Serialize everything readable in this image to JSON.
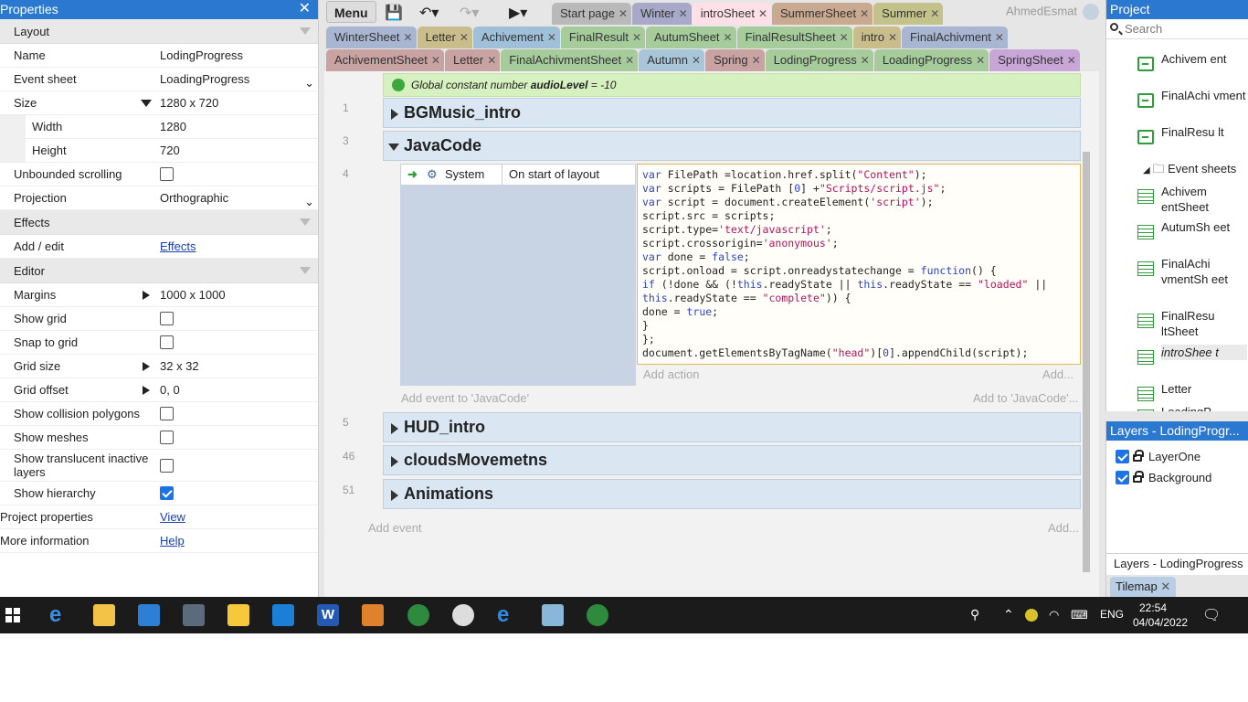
{
  "props": {
    "title": "Properties",
    "sections": {
      "layout": "Layout",
      "effects": "Effects",
      "editor": "Editor"
    },
    "rows": {
      "name": {
        "k": "Name",
        "v": "LodingProgress"
      },
      "event_sheet": {
        "k": "Event sheet",
        "v": "LoadingProgress"
      },
      "size": {
        "k": "Size",
        "v": "1280 x 720"
      },
      "width": {
        "k": "Width",
        "v": "1280"
      },
      "height": {
        "k": "Height",
        "v": "720"
      },
      "unbounded": {
        "k": "Unbounded scrolling"
      },
      "projection": {
        "k": "Projection",
        "v": "Orthographic"
      },
      "add_edit": {
        "k": "Add / edit",
        "v": "Effects"
      },
      "margins": {
        "k": "Margins",
        "v": "1000 x 1000"
      },
      "show_grid": {
        "k": "Show grid"
      },
      "snap": {
        "k": "Snap to grid"
      },
      "grid_size": {
        "k": "Grid size",
        "v": "32 x 32"
      },
      "grid_offset": {
        "k": "Grid offset",
        "v": "0, 0"
      },
      "collision": {
        "k": "Show collision polygons"
      },
      "meshes": {
        "k": "Show meshes"
      },
      "translucent": {
        "k": "Show translucent inactive layers"
      },
      "hierarchy": {
        "k": "Show hierarchy"
      },
      "project_props": {
        "k": "Project properties",
        "v": "View"
      },
      "more_info": {
        "k": "More information",
        "v": "Help"
      }
    }
  },
  "toolbar": {
    "menu": "Menu"
  },
  "user": {
    "name": "AhmedEsmat"
  },
  "tabs_row1": [
    {
      "label": "Start page",
      "color": "#b9b9b9"
    },
    {
      "label": "Winter",
      "color": "#a8a8c8"
    },
    {
      "label": "introSheet",
      "color": "#ffe0e8"
    },
    {
      "label": "SummerSheet",
      "color": "#c9a98f"
    },
    {
      "label": "Summer",
      "color": "#c2c28a"
    }
  ],
  "tabs_row2": [
    {
      "label": "WinterSheet",
      "color": "#a9b6d1"
    },
    {
      "label": "Letter",
      "color": "#c9bd8c"
    },
    {
      "label": "Achivement",
      "color": "#9fc0d8"
    },
    {
      "label": "FinalResult",
      "color": "#a6cc9c"
    },
    {
      "label": "AutumSheet",
      "color": "#a6cc9c"
    },
    {
      "label": "FinalResultSheet",
      "color": "#a6cc9c"
    },
    {
      "label": "intro",
      "color": "#c9bd8c"
    },
    {
      "label": "FinalAchivment",
      "color": "#a9b6d1"
    }
  ],
  "tabs_row3": [
    {
      "label": "AchivementSheet",
      "color": "#c9a2a2"
    },
    {
      "label": "Letter",
      "color": "#c9a2a2"
    },
    {
      "label": "FinalAchivmentSheet",
      "color": "#a6cc9c"
    },
    {
      "label": "Autumn",
      "color": "#a9c6d8"
    },
    {
      "label": "Spring",
      "color": "#c9a2a2"
    },
    {
      "label": "LodingProgress",
      "color": "#a6cc9c"
    },
    {
      "label": "LoadingProgress",
      "color": "#a6cc9c"
    },
    {
      "label": "SpringSheet",
      "color": "#c8a6d8"
    }
  ],
  "events": {
    "global": {
      "prefix": "Global constant number",
      "name": "audioLevel",
      "suffix": "= -10"
    },
    "groups": [
      {
        "line": "1",
        "label": "BGMusic_intro"
      },
      {
        "line": "3",
        "label": "JavaCode"
      },
      {
        "line": "5",
        "label": "HUD_intro"
      },
      {
        "line": "46",
        "label": "cloudsMovemetns"
      },
      {
        "line": "51",
        "label": "Animations"
      }
    ],
    "event_line": "4",
    "condition": {
      "object": "System",
      "text": "On start of layout"
    },
    "add_action": "Add action",
    "add_more": "Add...",
    "add_event_to": "Add event to 'JavaCode'",
    "add_to": "Add to 'JavaCode'...",
    "add_event": "Add event",
    "add_event_more": "Add..."
  },
  "project": {
    "title": "Project",
    "search_placeholder": "Search",
    "items": [
      {
        "label": "Achivem ent",
        "kind": "layout"
      },
      {
        "label": "FinalAchi vment",
        "kind": "layout"
      },
      {
        "label": "FinalResu lt",
        "kind": "layout"
      },
      {
        "label": "Event sheets",
        "kind": "folder"
      },
      {
        "label": "Achivem entSheet",
        "kind": "sheet"
      },
      {
        "label": "AutumSh eet",
        "kind": "sheet"
      },
      {
        "label": "FinalAchi vmentSh eet",
        "kind": "sheet"
      },
      {
        "label": "FinalResu ltSheet",
        "kind": "sheet"
      },
      {
        "label": "introShee t",
        "kind": "sheet"
      },
      {
        "label": "Letter",
        "kind": "sheet"
      },
      {
        "label": "LoadingP",
        "kind": "sheet"
      }
    ]
  },
  "layers": {
    "title": "Layers - LodingProgr...",
    "items": [
      {
        "label": "LayerOne"
      },
      {
        "label": "Background"
      }
    ],
    "footer_tab": "Layers - LodingProgress",
    "tilemap_tab": "Tilemap"
  },
  "taskbar": {
    "lang": "ENG",
    "time": "22:54",
    "date": "04/04/2022"
  }
}
